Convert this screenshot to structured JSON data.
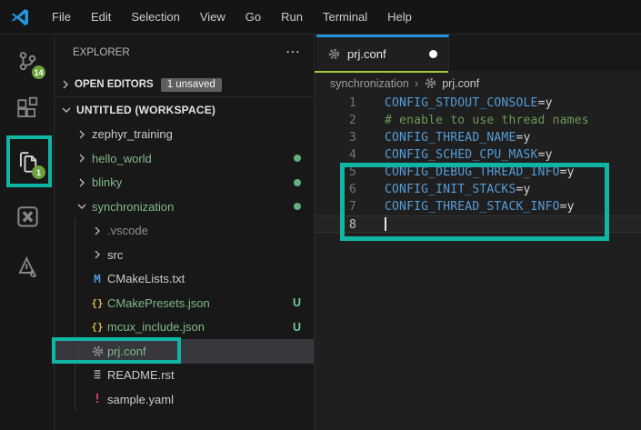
{
  "colors": {
    "annotation": "#10b5a4",
    "badge_green": "#6ca33e",
    "file_green": "#81b88b",
    "untracked": "#73c991",
    "key_blue": "#569cd6",
    "comment_green": "#6a9955",
    "plain": "#d4d4d4",
    "tab_border_top": "#2492db",
    "tab_underline": "#a6c73e",
    "json_yellow": "#d9b44a",
    "cmake_blue": "#4f9ce0",
    "yaml_pink": "#e0457b"
  },
  "titlebar": {
    "menu": [
      "File",
      "Edit",
      "Selection",
      "View",
      "Go",
      "Run",
      "Terminal",
      "Help"
    ]
  },
  "activity_bar": {
    "items": [
      {
        "name": "source-control",
        "icon": "source-control",
        "badge": "14"
      },
      {
        "name": "extensions",
        "icon": "extensions"
      },
      {
        "name": "explorer",
        "icon": "files",
        "badge": "1",
        "active": true
      },
      {
        "name": "x-box-extension",
        "icon": "x-box"
      },
      {
        "name": "triangle-wrench-extension",
        "icon": "debug-wrench"
      }
    ]
  },
  "sidebar": {
    "title": "EXPLORER",
    "more_actions": "⋯",
    "open_editors": {
      "label": "OPEN EDITORS",
      "badge": "1 unsaved"
    },
    "tree": [
      {
        "label": "UNTITLED (WORKSPACE)",
        "type": "ws-header",
        "chevron": "down"
      },
      {
        "label": "zephyr_training",
        "level": 0,
        "chevron": "right",
        "color": "white"
      },
      {
        "label": "hello_world",
        "level": 0,
        "chevron": "right",
        "color": "green",
        "dot": true
      },
      {
        "label": "blinky",
        "level": 0,
        "chevron": "right",
        "color": "green",
        "dot": true
      },
      {
        "label": "synchronization",
        "level": 0,
        "chevron": "down",
        "color": "green",
        "dot": true
      },
      {
        "label": ".vscode",
        "level": 1,
        "chevron": "right",
        "color": "dim"
      },
      {
        "label": "src",
        "level": 1,
        "chevron": "right",
        "color": "white"
      },
      {
        "label": "CMakeLists.txt",
        "level": 1,
        "icon": "cmake",
        "color": "white"
      },
      {
        "label": "CMakePresets.json",
        "level": 1,
        "icon": "json",
        "color": "green",
        "badge": "U"
      },
      {
        "label": "mcux_include.json",
        "level": 1,
        "icon": "json",
        "color": "green",
        "badge": "U"
      },
      {
        "label": "prj.conf",
        "level": 1,
        "icon": "gear",
        "color": "green",
        "selected": true
      },
      {
        "label": "README.rst",
        "level": 1,
        "icon": "rst",
        "color": "white"
      },
      {
        "label": "sample.yaml",
        "level": 1,
        "icon": "yaml",
        "color": "white"
      }
    ]
  },
  "editor": {
    "tab": {
      "label": "prj.conf",
      "modified": true
    },
    "breadcrumb": [
      "synchronization",
      "prj.conf"
    ],
    "lines": [
      {
        "num": "1",
        "tokens": [
          {
            "t": "CONFIG_STDOUT_CONSOLE",
            "c": "key"
          },
          {
            "t": "=y",
            "c": "plain"
          }
        ]
      },
      {
        "num": "2",
        "tokens": [
          {
            "t": "# enable to use thread names",
            "c": "comment"
          }
        ]
      },
      {
        "num": "3",
        "tokens": [
          {
            "t": "CONFIG_THREAD_NAME",
            "c": "key"
          },
          {
            "t": "=y",
            "c": "plain"
          }
        ]
      },
      {
        "num": "4",
        "tokens": [
          {
            "t": "CONFIG_SCHED_CPU_MASK",
            "c": "key"
          },
          {
            "t": "=y",
            "c": "plain"
          }
        ]
      },
      {
        "num": "5",
        "tokens": [
          {
            "t": "CONFIG_DEBUG_THREAD_INFO",
            "c": "key"
          },
          {
            "t": "=y",
            "c": "plain"
          }
        ]
      },
      {
        "num": "6",
        "tokens": [
          {
            "t": "CONFIG_INIT_STACKS",
            "c": "key"
          },
          {
            "t": "=y",
            "c": "plain"
          }
        ]
      },
      {
        "num": "7",
        "tokens": [
          {
            "t": "CONFIG_THREAD_STACK_INFO",
            "c": "key"
          },
          {
            "t": "=y",
            "c": "plain"
          }
        ]
      },
      {
        "num": "8",
        "tokens": [],
        "cursor": true,
        "current": true
      }
    ]
  }
}
